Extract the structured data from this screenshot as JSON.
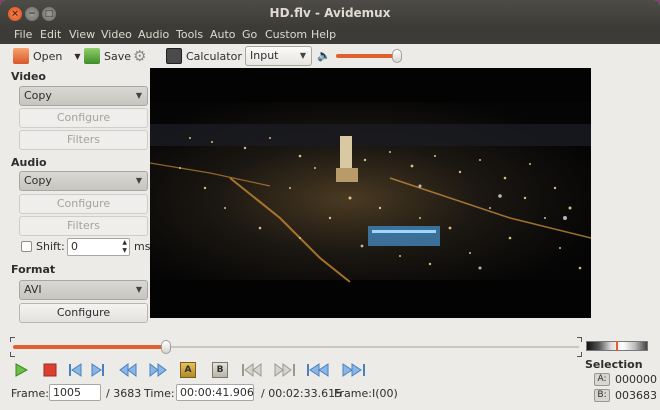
{
  "window": {
    "title": "HD.flv - Avidemux",
    "close_glyph": "×",
    "min_glyph": "−",
    "max_glyph": "□"
  },
  "menu": [
    "File",
    "Edit",
    "View",
    "Video",
    "Audio",
    "Tools",
    "Auto",
    "Go",
    "Custom",
    "Help"
  ],
  "toolbar": {
    "open_label": "Open",
    "save_label": "Save",
    "calculator_label": "Calculator",
    "input_select": "Input",
    "volume_level": 0.95
  },
  "video": {
    "section": "Video",
    "codec": "Copy",
    "configure": "Configure",
    "filters": "Filters"
  },
  "audio": {
    "section": "Audio",
    "codec": "Copy",
    "configure": "Configure",
    "filters": "Filters",
    "shift_label": "Shift:",
    "shift_value": "0",
    "shift_unit": "ms"
  },
  "format": {
    "section": "Format",
    "container": "AVI",
    "configure": "Configure"
  },
  "timeline": {
    "position": 0.27
  },
  "status": {
    "frame_label": "Frame:",
    "frame_value": "1005",
    "total_frames": "/ 3683",
    "time_label": "Time:",
    "time_value": "00:00:41.906",
    "duration": "/ 00:02:33.615",
    "frame_type": "Frame:I(00)"
  },
  "selection": {
    "title": "Selection",
    "a_label": "A:",
    "a_value": "000000",
    "b_label": "B:",
    "b_value": "003683"
  },
  "colors": {
    "accent": "#e0602f",
    "titlebar": "#3c3b37",
    "window_bg": "#ecebe8"
  }
}
